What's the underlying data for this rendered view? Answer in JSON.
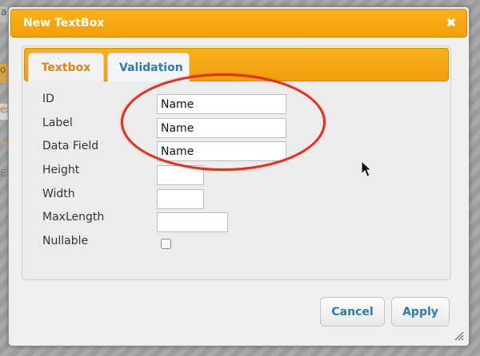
{
  "background": {
    "strip_top": "a",
    "strip_orange": "o",
    "strip_mid": "ex",
    "strip_low": "E"
  },
  "dialog": {
    "title": "New TextBox",
    "close_glyph": "✖",
    "accent_color": "#f5a611",
    "link_color": "#2a7db0"
  },
  "tabs": [
    {
      "label": "Textbox",
      "active": true
    },
    {
      "label": "Validation",
      "active": false
    }
  ],
  "fields": {
    "id": {
      "label": "ID",
      "value": "Name"
    },
    "label": {
      "label": "Label",
      "value": "Name"
    },
    "data_field": {
      "label": "Data Field",
      "value": "Name"
    },
    "height": {
      "label": "Height",
      "value": ""
    },
    "width": {
      "label": "Width",
      "value": ""
    },
    "max_length": {
      "label": "MaxLength",
      "value": ""
    },
    "nullable": {
      "label": "Nullable",
      "checked": false
    }
  },
  "buttons": {
    "cancel": "Cancel",
    "apply": "Apply"
  },
  "icons": {
    "close": "close-icon",
    "resize": "resize-grip-icon",
    "cursor": "mouse-pointer-icon"
  },
  "annotation": {
    "color": "#e0301e",
    "shape": "ellipse"
  }
}
